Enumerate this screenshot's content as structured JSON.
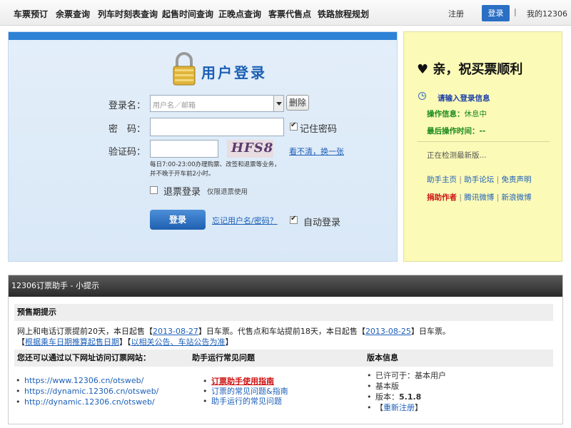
{
  "nav": {
    "items": [
      "车票预订",
      "余票查询",
      "列车时刻表查询",
      "起售时间查询",
      "正晚点查询",
      "客票代售点",
      "铁路旅程规划"
    ],
    "register": "注册",
    "login": "登录",
    "my12306": "我的12306",
    "separator": "|"
  },
  "login": {
    "title": "用户登录",
    "username_label": "登录名：",
    "username_placeholder": "用户名／邮箱",
    "delete_button": "删除",
    "password_label": "密　码：",
    "remember_password": "记住密码",
    "captcha_label": "验证码：",
    "captcha_text": "HFS8",
    "captcha_refresh": "看不清，换一张",
    "hours_hint": "每日7:00-23:00办理购票、改签和退票等业务，并不晚于开车前2小时。",
    "refund_label": "退票登录",
    "refund_note": "仅限退票使用",
    "submit": "登录",
    "forgot": "忘记用户名/密码？",
    "auto_login": "自动登录"
  },
  "greeting": {
    "title": "♥ 亲，祝买票顺利",
    "prompt": "请输入登录信息",
    "op_info_label": "操作信息：",
    "op_info_value": "休息中",
    "last_op_label": "最后操作时间：",
    "last_op_value": "--",
    "checking": "正在检测最新版...",
    "links1": [
      "助手主页",
      "助手论坛",
      "免责声明"
    ],
    "author_label": "捐助作者",
    "links2": [
      "腾讯微博",
      "新浪微博"
    ]
  },
  "tips": {
    "header": "12306订票助手 - 小提示",
    "presale_title": "预售期提示",
    "presale_line1_a": "网上和电话订票提前20天，本日起售【",
    "presale_date1": "2013-08-27",
    "presale_line1_b": "】日车票。代售点和车站提前18天，本日起售【",
    "presale_date2": "2013-08-25",
    "presale_line1_c": "】日车票。",
    "presale_line2_a": "【",
    "presale_link2": "根据乘车日期推算起售日期",
    "presale_line2_b": "】【",
    "presale_link3": "以相关公告、车站公告为准",
    "presale_line2_c": "】",
    "col1_title": "您还可以通过以下网址访问订票网站：",
    "urls": [
      "https://www.12306.cn/otsweb/",
      "https://dynamic.12306.cn/otsweb/",
      "http://dynamic.12306.cn/otsweb/"
    ],
    "col2_title": "助手运行常见问题",
    "faq": [
      "订票助手使用指南",
      "订票的常见问题&指南",
      "助手运行的常见问题"
    ],
    "col3_title": "版本信息",
    "version_items": {
      "licensed": "已许可于：基本用户",
      "edition": "基本版",
      "version_label": "版本：",
      "version_value": "5.1.8",
      "reregister_a": "【",
      "reregister": "重新注册",
      "reregister_b": "】"
    }
  }
}
